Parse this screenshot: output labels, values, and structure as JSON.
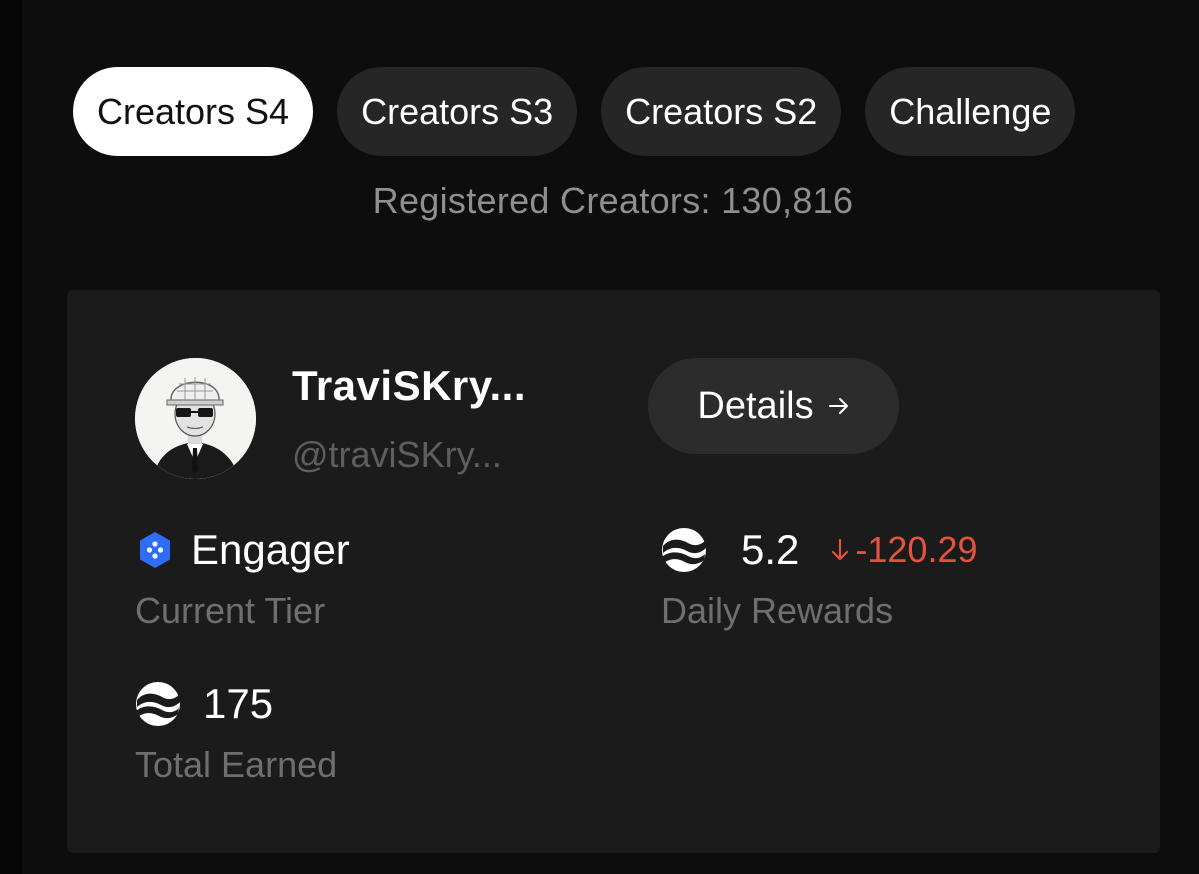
{
  "tabs": [
    {
      "label": "Creators S4",
      "active": true
    },
    {
      "label": "Creators S3",
      "active": false
    },
    {
      "label": "Creators S2",
      "active": false
    },
    {
      "label": "Challenge",
      "active": false
    }
  ],
  "registered_text": "Registered Creators: 130,816",
  "profile": {
    "name": "TraviSKry...",
    "handle": "@traviSKry...",
    "details_label": "Details"
  },
  "tier": {
    "value": "Engager",
    "label": "Current Tier",
    "icon": "hexagon-badge-icon",
    "color": "#2f6df5"
  },
  "daily_rewards": {
    "value": "5.2",
    "change": "-120.29",
    "change_icon": "arrow-down-icon",
    "change_color": "#e5533f",
    "label": "Daily Rewards",
    "icon": "token-logo-icon"
  },
  "total_earned": {
    "value": "175",
    "label": "Total Earned",
    "icon": "token-logo-icon"
  }
}
